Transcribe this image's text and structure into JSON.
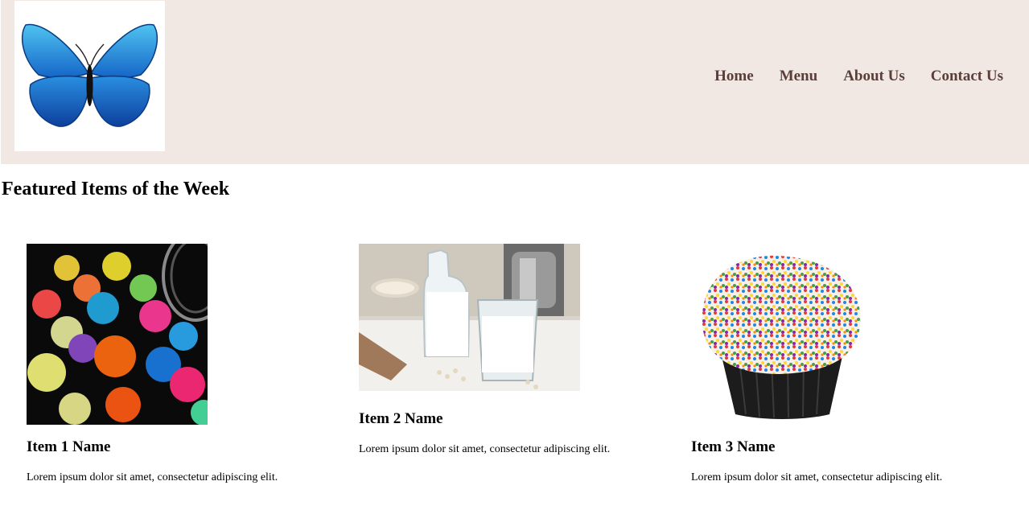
{
  "nav": {
    "items": [
      "Home",
      "Menu",
      "About Us",
      "Contact Us"
    ]
  },
  "logo": {
    "icon": "butterfly-icon"
  },
  "section": {
    "title": "Featured Items of the Week"
  },
  "items": [
    {
      "name": "Item 1 Name",
      "description": "Lorem ipsum dolor sit amet, consectetur adipiscing elit.",
      "image": "gummy-bears-image"
    },
    {
      "name": "Item 2 Name",
      "description": "Lorem ipsum dolor sit amet, consectetur adipiscing elit.",
      "image": "milk-bottle-image"
    },
    {
      "name": "Item 3 Name",
      "description": "Lorem ipsum dolor sit amet, consectetur adipiscing elit.",
      "image": "sprinkle-cupcake-image"
    }
  ],
  "colors": {
    "header_bg": "#f2e8e3",
    "nav_text": "#5a3e3a",
    "butterfly_blue": "#1f7fd8"
  }
}
